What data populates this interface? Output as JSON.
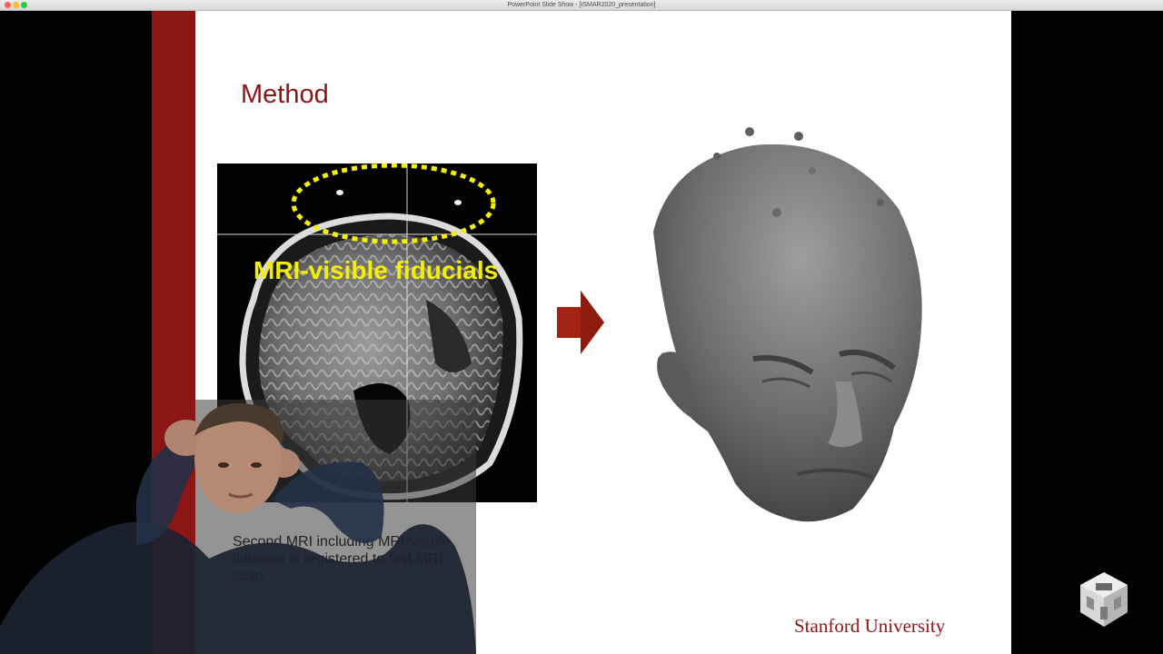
{
  "window": {
    "title": "PowerPoint Slide Show - [ISMAR2020_presentation]"
  },
  "slide": {
    "title": "Method",
    "mri_label": "MRI-visible fiducials",
    "caption_lines": [
      "Second MRI including MRI-visible",
      "fiducials is registered to first MRI",
      "scan."
    ],
    "footer": "Stanford University"
  },
  "colors": {
    "accent": "#8c1515",
    "fiducial_highlight": "#f5f000"
  },
  "icons": [
    "close-button",
    "minimize-button",
    "maximize-button",
    "arrow-right-icon",
    "cube-logo-icon"
  ]
}
